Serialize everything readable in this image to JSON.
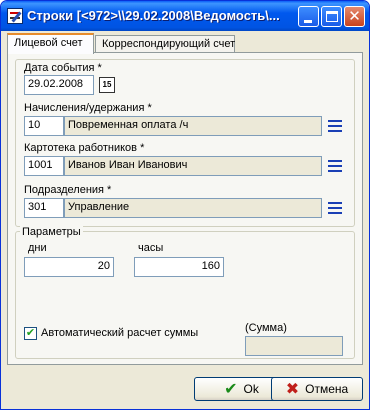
{
  "window": {
    "title": "Строки [<972>\\\\29.02.2008\\Ведомость\\..."
  },
  "tabs": [
    {
      "label": "Лицевой счет",
      "active": true
    },
    {
      "label": "Корреспондирующий счет",
      "active": false
    }
  ],
  "form": {
    "event_date": {
      "label": "Дата события *",
      "value": "29.02.2008",
      "calendar_icon": "15"
    },
    "accrual": {
      "label": "Начисления/удержания *",
      "code": "10",
      "name": "Повременная оплата /ч"
    },
    "employee": {
      "label": "Картотека работников *",
      "code": "1001",
      "name": "Иванов Иван Иванович"
    },
    "department": {
      "label": "Подразделения *",
      "code": "301",
      "name": "Управление"
    }
  },
  "parameters": {
    "group_label": "Параметры",
    "days_label": "дни",
    "days_value": "20",
    "hours_label": "часы",
    "hours_value": "160",
    "auto_calc_label": "Автоматический расчет суммы",
    "auto_calc_checked": true,
    "sum_label": "(Сумма)",
    "sum_value": ""
  },
  "buttons": {
    "ok": "Ok",
    "cancel": "Отмена"
  },
  "colors": {
    "titlebar": "#0054e3",
    "window_bg": "#ece9d8",
    "lookup_icon": "#1a3fb5",
    "ok_icon": "#1a8a1a",
    "cancel_icon": "#c0201a"
  }
}
